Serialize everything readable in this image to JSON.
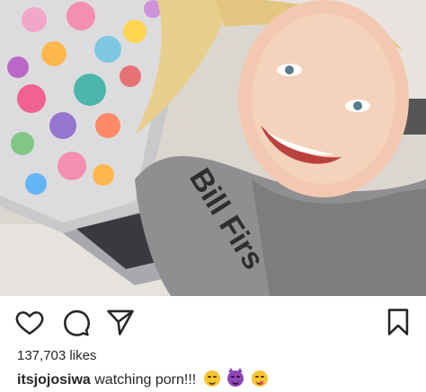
{
  "post": {
    "likes_count": "137,703",
    "likes_word": "likes",
    "caption_user": "itsjojosiwa",
    "caption_text": "watching porn!!!",
    "caption_emojis": [
      "relieved-face-emoji",
      "smiling-face-with-horns-emoji",
      "face-savoring-food-emoji"
    ],
    "photo_shirt_text": "Bill Firs"
  },
  "actions": {
    "icons": [
      "heart-icon",
      "comment-icon",
      "share-icon",
      "bookmark-icon"
    ]
  },
  "colors": {
    "text": "#262626",
    "background": "#ffffff"
  }
}
